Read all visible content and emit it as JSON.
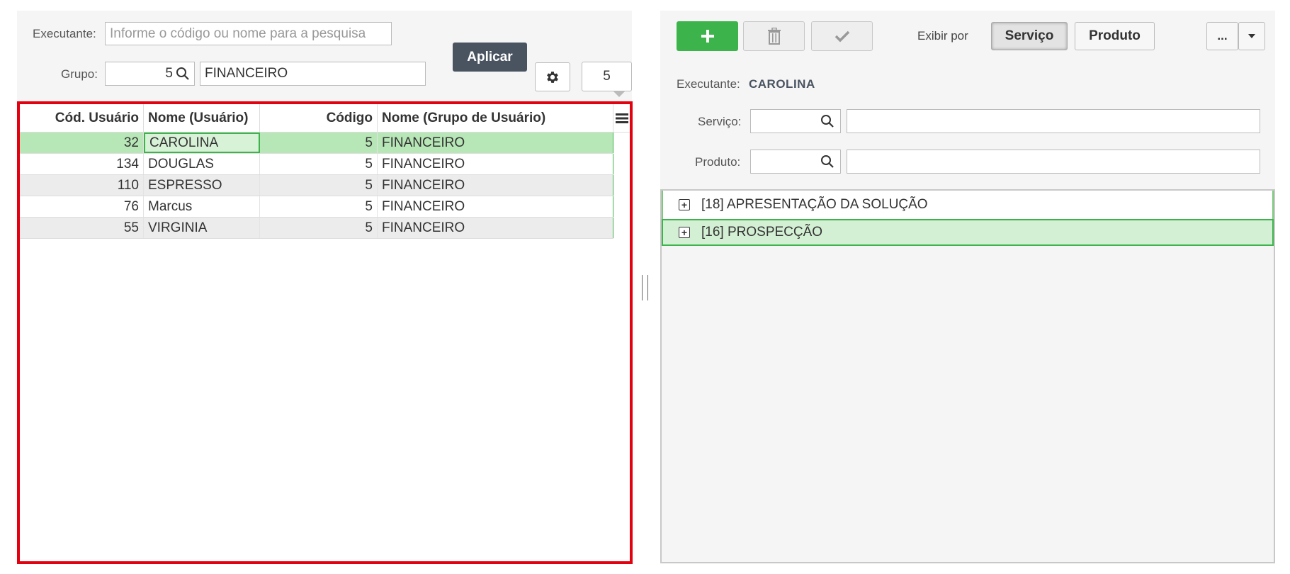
{
  "left": {
    "executante_label": "Executante:",
    "executante_placeholder": "Informe o código ou nome para a pesquisa",
    "grupo_label": "Grupo:",
    "grupo_code": "5",
    "grupo_name": "FINANCEIRO",
    "apply_label": "Aplicar",
    "count_value": "5"
  },
  "grid": {
    "columns": [
      "Cód. Usuário",
      "Nome (Usuário)",
      "Código",
      "Nome (Grupo de Usuário)"
    ],
    "rows": [
      {
        "cod": "32",
        "nome": "CAROLINA",
        "codigo": "5",
        "grupo": "FINANCEIRO"
      },
      {
        "cod": "134",
        "nome": "DOUGLAS",
        "codigo": "5",
        "grupo": "FINANCEIRO"
      },
      {
        "cod": "110",
        "nome": "ESPRESSO",
        "codigo": "5",
        "grupo": "FINANCEIRO"
      },
      {
        "cod": "76",
        "nome": "Marcus",
        "codigo": "5",
        "grupo": "FINANCEIRO"
      },
      {
        "cod": "55",
        "nome": "VIRGINIA",
        "codigo": "5",
        "grupo": "FINANCEIRO"
      }
    ]
  },
  "right": {
    "add_icon": "plus-icon",
    "delete_icon": "trash-icon",
    "confirm_icon": "check-icon",
    "exibir_label": "Exibir por",
    "toggle_servico": "Serviço",
    "toggle_produto": "Produto",
    "more_label": "...",
    "executante_label": "Executante:",
    "executante_value": "CAROLINA",
    "servico_label": "Serviço:",
    "produto_label": "Produto:",
    "tree_items": [
      {
        "label": "[18] APRESENTAÇÃO DA SOLUÇÃO"
      },
      {
        "label": "[16] PROSPECÇÃO"
      }
    ]
  },
  "colors": {
    "accent_green": "#3cb44b",
    "selected_row": "#b7e6b7",
    "grid_border": "#e3000f",
    "dark_button": "#4a5461"
  }
}
